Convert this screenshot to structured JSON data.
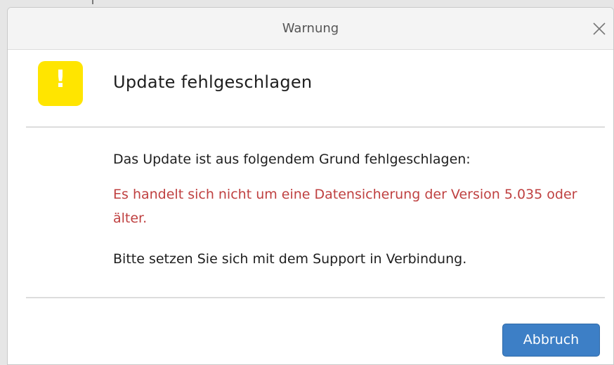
{
  "window": {
    "title": "Warnung",
    "close_icon": "close-icon"
  },
  "warning_icon": "warning-icon",
  "dialog": {
    "heading": "Update fehlgeschlagen",
    "intro": "Das Update ist aus folgendem Grund fehlgeschlagen:",
    "error": "Es handelt sich nicht um eine Datensicherung der Version 5.035 oder älter.",
    "support": "Bitte setzen Sie sich mit dem Support in Verbindung."
  },
  "buttons": {
    "cancel_label": "Abbruch"
  },
  "colors": {
    "warning_yellow": "#ffe500",
    "error_text": "#bf4040",
    "button_blue": "#3d7fc6"
  }
}
